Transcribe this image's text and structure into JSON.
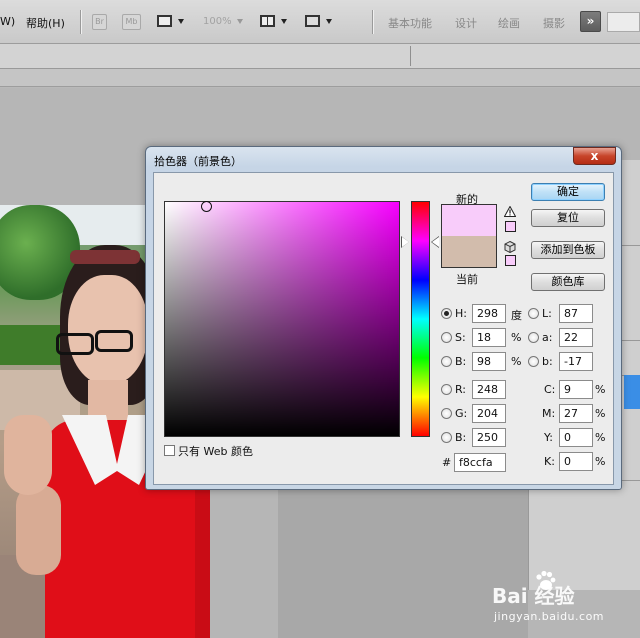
{
  "menubar": {
    "items": [
      "W)",
      "帮助(H)"
    ],
    "br_label": "Br",
    "mb_label": "Mb",
    "zoom": "100%",
    "workspaces": [
      "基本功能",
      "设计",
      "绘画",
      "摄影"
    ],
    "more_label": "»"
  },
  "dialog": {
    "title": "拾色器（前景色）",
    "close_label": "x",
    "new_label": "新的",
    "current_label": "当前",
    "new_color": "#f8ccfa",
    "current_color": "#d2bcac",
    "buttons": {
      "ok": "确定",
      "reset": "复位",
      "add_to_swatches": "添加到色板",
      "color_libraries": "颜色库"
    },
    "hsb": {
      "h": {
        "label": "H:",
        "value": "298",
        "unit": "度"
      },
      "s": {
        "label": "S:",
        "value": "18",
        "unit": "%"
      },
      "b": {
        "label": "B:",
        "value": "98",
        "unit": "%"
      }
    },
    "rgb": {
      "r": {
        "label": "R:",
        "value": "248"
      },
      "g": {
        "label": "G:",
        "value": "204"
      },
      "b": {
        "label": "B:",
        "value": "250"
      }
    },
    "lab": {
      "l": {
        "label": "L:",
        "value": "87"
      },
      "a": {
        "label": "a:",
        "value": "22"
      },
      "b": {
        "label": "b:",
        "value": "-17"
      }
    },
    "cmyk": {
      "c": {
        "label": "C:",
        "value": "9",
        "unit": "%"
      },
      "m": {
        "label": "M:",
        "value": "27",
        "unit": "%"
      },
      "y": {
        "label": "Y:",
        "value": "0",
        "unit": "%"
      },
      "k": {
        "label": "K:",
        "value": "0",
        "unit": "%"
      }
    },
    "hex": {
      "label": "#",
      "value": "f8ccfa"
    },
    "web_only_label": "只有 Web 颜色",
    "hue_degrees": 298
  },
  "watermark": {
    "brand": "Bai  经验",
    "url": "jingyan.baidu.com"
  }
}
